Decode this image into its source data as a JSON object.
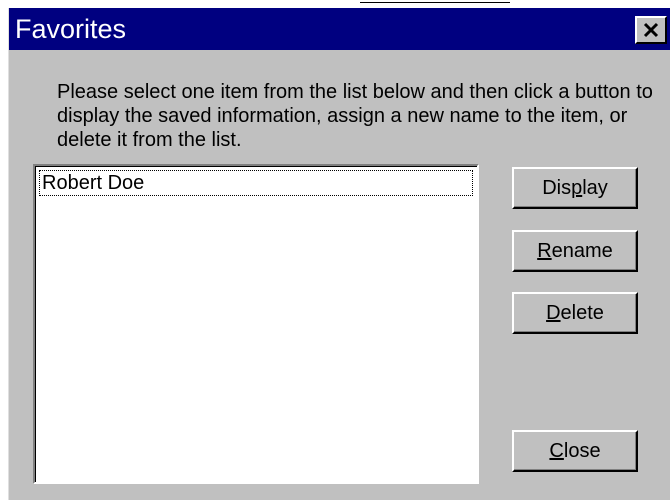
{
  "window": {
    "title": "Favorites",
    "close_icon": "close-x-icon"
  },
  "instructions": "Please select one item from the list below and then click a button to display the saved information, assign a new name to the item, or delete it from the list.",
  "favorites_list": {
    "items": [
      {
        "label": "Robert Doe",
        "focused": true
      }
    ]
  },
  "buttons": {
    "display": {
      "before": "Dis",
      "mnemonic": "p",
      "after": "lay"
    },
    "rename": {
      "before": "",
      "mnemonic": "R",
      "after": "ename"
    },
    "delete": {
      "before": "",
      "mnemonic": "D",
      "after": "elete"
    },
    "close": {
      "before": "",
      "mnemonic": "C",
      "after": "lose"
    }
  },
  "colors": {
    "title_bar": "#000080",
    "dialog_face": "#c0c0c0",
    "title_text": "#ffffff"
  }
}
